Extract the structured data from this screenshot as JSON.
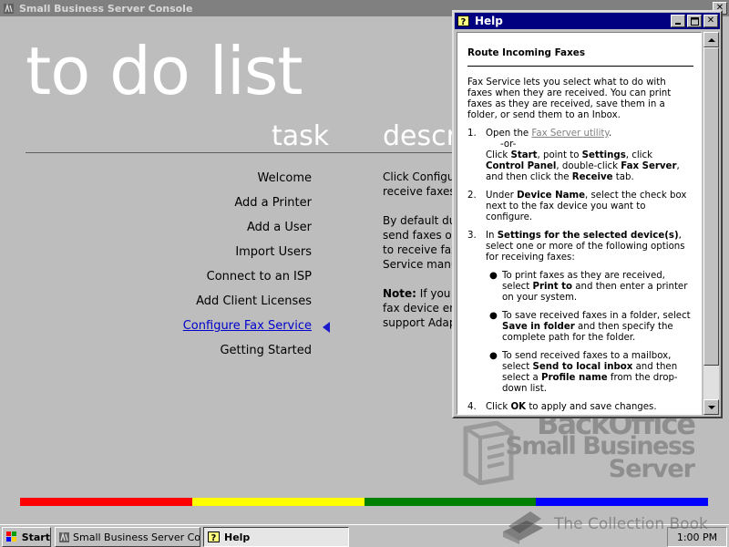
{
  "console": {
    "title": "Small Business Server Console",
    "heading": "to do list",
    "column_task": "task",
    "column_description": "descri",
    "tasks": [
      {
        "label": "Welcome"
      },
      {
        "label": "Add a Printer"
      },
      {
        "label": "Add a User"
      },
      {
        "label": "Import Users"
      },
      {
        "label": "Connect to an ISP"
      },
      {
        "label": "Add Client Licenses"
      },
      {
        "label": "Configure Fax Service"
      },
      {
        "label": "Getting Started"
      }
    ],
    "active_task_index": 6,
    "description": {
      "p1_l1": "Click Configu",
      "p1_l2": "receive faxes",
      "p2_l1": "By default dur",
      "p2_l2": "send faxes or",
      "p2_l3": "to receive fax",
      "p2_l4": "Service manu",
      "p3_label": "Note:",
      "p3_l1": " If you",
      "p3_l2": "fax device en",
      "p3_l3": "support Adap"
    },
    "logo": {
      "line1": "BackOffice",
      "line2": "Small Business",
      "line3": "Server"
    },
    "color_bar": [
      "#ff0000",
      "#ffff00",
      "#008000",
      "#0000ff"
    ]
  },
  "help": {
    "title": "Help",
    "topic": "Route Incoming Faxes",
    "intro": "Fax Service lets you select what to do with faxes when they are received. You can print faxes as they are received, save them in a folder, or send them to an Inbox.",
    "step1": {
      "num": "1.",
      "open_prefix": "Open the ",
      "link": "Fax Server utility",
      "open_suffix": ".",
      "or": "-or-",
      "t1": "Click ",
      "b1": "Start",
      "t2": ", point to ",
      "b2": "Settings",
      "t3": ", click ",
      "b3": "Control Panel",
      "t4": ", double-click ",
      "b4": "Fax Server",
      "t5": ", and then click the ",
      "b5": "Receive",
      "t6": " tab."
    },
    "step2": {
      "num": "2.",
      "t1": "Under ",
      "b1": "Device Name",
      "t2": ", select the check box next to the fax device you want to configure."
    },
    "step3": {
      "num": "3.",
      "t1": "In ",
      "b1": "Settings for the selected device(s)",
      "t2": ", select one or more of the following options for receiving faxes:",
      "bullet1": {
        "t1": "To print faxes as they are received, select ",
        "b1": "Print to",
        "t2": " and then enter a printer on your system."
      },
      "bullet2": {
        "t1": "To save received faxes in a folder, select ",
        "b1": "Save in folder",
        "t2": " and then specify the complete path for the folder."
      },
      "bullet3": {
        "t1": "To send received faxes to a mailbox, select ",
        "b1": "Send to local inbox",
        "t2": " and then select a ",
        "b2": "Profile name",
        "t3": " from the drop-down list."
      }
    },
    "step4": {
      "num": "4.",
      "t1": "Click ",
      "b1": "OK",
      "t2": " to apply and save changes."
    }
  },
  "taskbar": {
    "start": "Start",
    "task_console": "Small Business Server Con...",
    "task_help": "Help",
    "clock": "1:00 PM"
  },
  "watermark": "The Collection Book",
  "icons": {
    "minimize": "minimize-icon",
    "maximize": "maximize-icon",
    "close": "close-icon",
    "help_window": "help-question-icon",
    "windows_logo": "windows-logo-icon"
  }
}
